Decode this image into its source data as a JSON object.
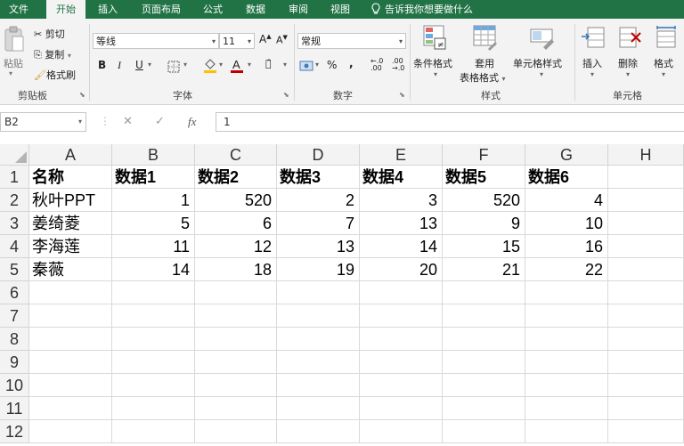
{
  "tabs": [
    {
      "label": "文件"
    },
    {
      "label": "开始",
      "active": true
    },
    {
      "label": "插入"
    },
    {
      "label": "页面布局"
    },
    {
      "label": "公式"
    },
    {
      "label": "数据"
    },
    {
      "label": "审阅"
    },
    {
      "label": "视图"
    }
  ],
  "tell_me": "告诉我你想要做什么",
  "ribbon": {
    "clipboard": {
      "paste": "粘贴",
      "cut": "剪切",
      "copy": "复制",
      "format_painter": "格式刷",
      "group": "剪贴板"
    },
    "font": {
      "name": "等线",
      "size": "11",
      "bold": "B",
      "italic": "I",
      "underline": "U",
      "grow": "A",
      "shrink": "A",
      "group": "字体"
    },
    "number": {
      "format": "常规",
      "percent": "%",
      "comma": ",",
      "group": "数字"
    },
    "styles": {
      "conditional": "条件格式",
      "table_l1": "套用",
      "table_l2": "表格格式",
      "cell_styles": "单元格样式",
      "group": "样式"
    },
    "cells": {
      "insert": "插入",
      "delete": "删除",
      "format": "格式",
      "group": "单元格"
    }
  },
  "formula_bar": {
    "name_box": "B2",
    "fx": "fx",
    "value": "1"
  },
  "sheet": {
    "columns": [
      "A",
      "B",
      "C",
      "D",
      "E",
      "F",
      "G",
      "H"
    ],
    "rows": [
      "1",
      "2",
      "3",
      "4",
      "5",
      "6",
      "7",
      "8",
      "9",
      "10",
      "11",
      "12"
    ],
    "cells": [
      [
        "名称",
        "数据1",
        "数据2",
        "数据3",
        "数据4",
        "数据5",
        "数据6",
        ""
      ],
      [
        "秋叶PPT",
        "1",
        "520",
        "2",
        "3",
        "520",
        "4",
        ""
      ],
      [
        "姜绮菱",
        "5",
        "6",
        "7",
        "13",
        "9",
        "10",
        ""
      ],
      [
        "李海莲",
        "11",
        "12",
        "13",
        "14",
        "15",
        "16",
        ""
      ],
      [
        "秦薇",
        "14",
        "18",
        "19",
        "20",
        "21",
        "22",
        ""
      ]
    ]
  },
  "colors": {
    "accent": "#217346",
    "ribbon_bg": "#f3f3f3",
    "grid_line": "#d9d9d9"
  }
}
